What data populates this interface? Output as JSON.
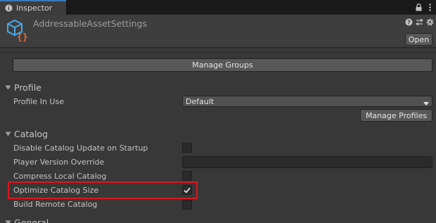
{
  "tab": {
    "label": "Inspector"
  },
  "header": {
    "title": "AddressableAssetSettings",
    "open_label": "Open",
    "icons": [
      "help-icon",
      "preset-icon",
      "settings-icon"
    ]
  },
  "main": {
    "manage_groups_label": "Manage Groups",
    "profile": {
      "section_label": "Profile",
      "profile_in_use_label": "Profile In Use",
      "profile_in_use_value": "Default",
      "manage_profiles_label": "Manage Profiles"
    },
    "catalog": {
      "section_label": "Catalog",
      "fields": [
        {
          "label": "Disable Catalog Update on Startup",
          "type": "checkbox",
          "checked": false
        },
        {
          "label": "Player Version Override",
          "type": "text",
          "value": ""
        },
        {
          "label": "Compress Local Catalog",
          "type": "checkbox",
          "checked": false
        },
        {
          "label": "Optimize Catalog Size",
          "type": "checkbox",
          "checked": true,
          "highlighted": true
        },
        {
          "label": "Build Remote Catalog",
          "type": "checkbox",
          "checked": false
        }
      ]
    },
    "general": {
      "section_label": "General"
    }
  },
  "colors": {
    "highlight": "#d6191f",
    "tab_accent": "#3a79bb",
    "asset_icon_blue": "#4aa8e8",
    "asset_icon_orange": "#f26b2a"
  }
}
